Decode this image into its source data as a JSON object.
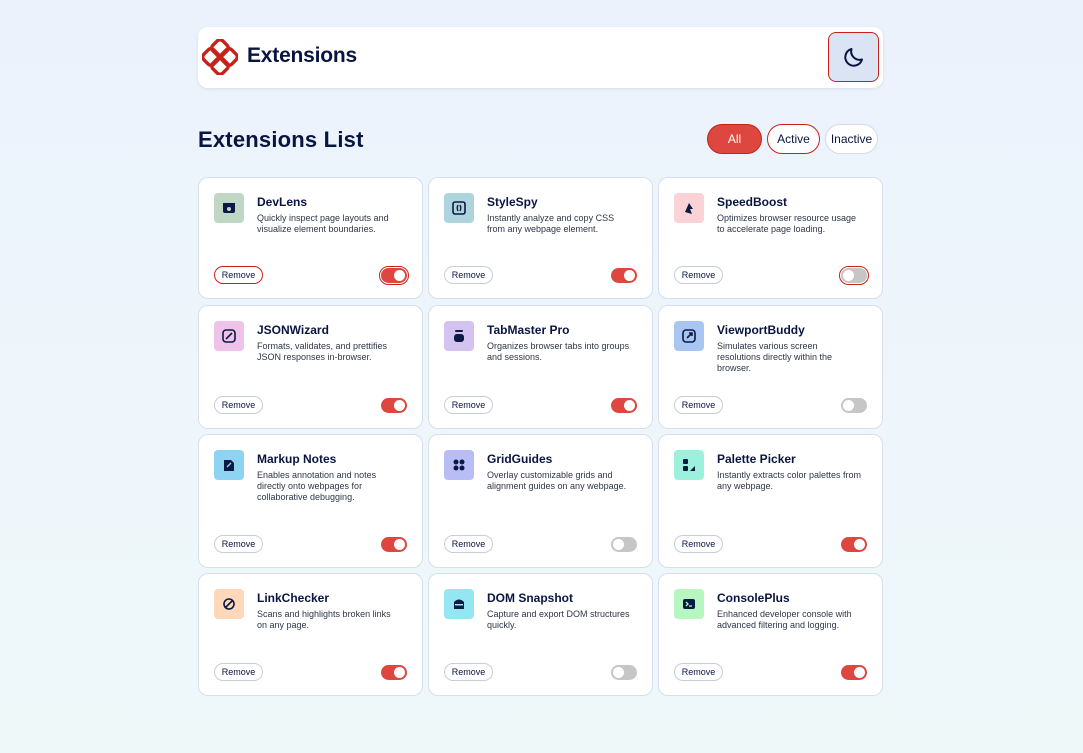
{
  "header": {
    "brand": "Extensions",
    "theme_button": "moon-icon"
  },
  "list": {
    "title": "Extensions List",
    "filters": [
      {
        "label": "All",
        "selected": true
      },
      {
        "label": "Active",
        "selected": false
      },
      {
        "label": "Inactive",
        "selected": false
      }
    ]
  },
  "actions": {
    "remove_label": "Remove"
  },
  "colors": {
    "accent": "#de473f",
    "accent_dark": "#c7221a",
    "text": "#091540",
    "toggle_off": "#c6c6c6"
  },
  "extensions": [
    {
      "name": "DevLens",
      "description": "Quickly inspect page layouts and visualize element boundaries.",
      "active": true,
      "icon": "devlens-icon",
      "icon_bg": "#bfd7c4"
    },
    {
      "name": "StyleSpy",
      "description": "Instantly analyze and copy CSS from any webpage element.",
      "active": true,
      "icon": "stylespy-icon",
      "icon_bg": "#aed4dd"
    },
    {
      "name": "SpeedBoost",
      "description": "Optimizes browser resource usage to accelerate page loading.",
      "active": false,
      "icon": "speedboost-icon",
      "icon_bg": "#fbd3d6"
    },
    {
      "name": "JSONWizard",
      "description": "Formats, validates, and prettifies JSON responses in-browser.",
      "active": true,
      "icon": "jsonwizard-icon",
      "icon_bg": "#eec2e9"
    },
    {
      "name": "TabMaster Pro",
      "description": "Organizes browser tabs into groups and sessions.",
      "active": true,
      "icon": "tabmaster-icon",
      "icon_bg": "#d4c2f1"
    },
    {
      "name": "ViewportBuddy",
      "description": "Simulates various screen resolutions directly within the browser.",
      "active": false,
      "icon": "viewportbuddy-icon",
      "icon_bg": "#a9c6f3"
    },
    {
      "name": "Markup Notes",
      "description": "Enables annotation and notes directly onto webpages for collaborative debugging.",
      "active": true,
      "icon": "markupnotes-icon",
      "icon_bg": "#8fd3f2"
    },
    {
      "name": "GridGuides",
      "description": "Overlay customizable grids and alignment guides on any webpage.",
      "active": false,
      "icon": "gridguides-icon",
      "icon_bg": "#b9bdf6"
    },
    {
      "name": "Palette Picker",
      "description": "Instantly extracts color palettes from any webpage.",
      "active": true,
      "icon": "palettepicker-icon",
      "icon_bg": "#9df1dc"
    },
    {
      "name": "LinkChecker",
      "description": "Scans and highlights broken links on any page.",
      "active": true,
      "icon": "linkchecker-icon",
      "icon_bg": "#ffd8bc"
    },
    {
      "name": "DOM Snapshot",
      "description": "Capture and export DOM structures quickly.",
      "active": false,
      "icon": "domsnapshot-icon",
      "icon_bg": "#94e6f2"
    },
    {
      "name": "ConsolePlus",
      "description": "Enhanced developer console with advanced filtering and logging.",
      "active": true,
      "icon": "consoleplus-icon",
      "icon_bg": "#b6f6c0"
    }
  ]
}
